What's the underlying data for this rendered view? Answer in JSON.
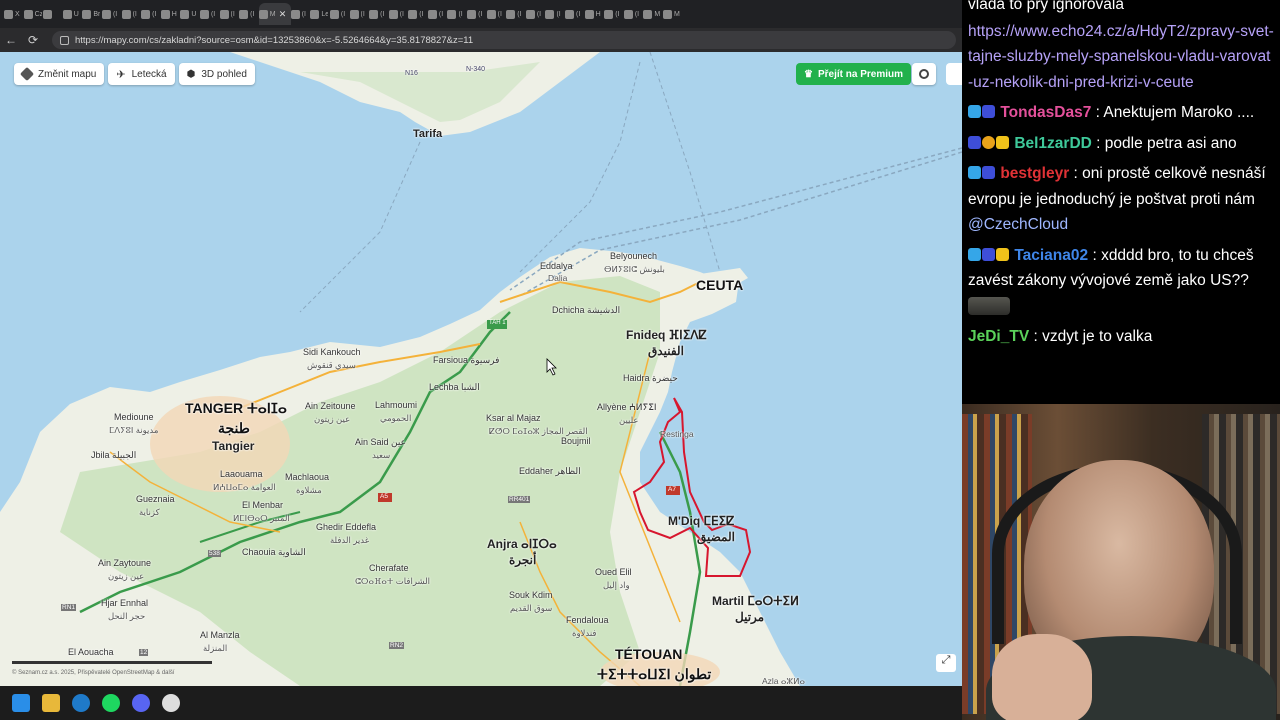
{
  "browser": {
    "tabs": [
      {
        "icon": "x-icon",
        "title": "X"
      },
      {
        "icon": "tab-icon",
        "title": "Cz"
      },
      {
        "icon": "tab-icon",
        "title": ""
      },
      {
        "icon": "tab-icon",
        "title": "U"
      },
      {
        "icon": "globe-icon",
        "title": "Br"
      },
      {
        "icon": "tab-icon",
        "title": "(I"
      },
      {
        "icon": "x-icon",
        "title": "(I"
      },
      {
        "icon": "x-icon",
        "title": "(I"
      },
      {
        "icon": "x-icon",
        "title": "H"
      },
      {
        "icon": "tab-icon",
        "title": "U"
      },
      {
        "icon": "x-icon",
        "title": "(I"
      },
      {
        "icon": "x-icon",
        "title": "(I"
      },
      {
        "icon": "x-icon",
        "title": "(I"
      },
      {
        "icon": "mapy-icon",
        "title": "M"
      },
      {
        "icon": "x-icon",
        "title": "(I"
      },
      {
        "icon": "tab-icon",
        "title": "Le"
      },
      {
        "icon": "x-icon",
        "title": "(I"
      },
      {
        "icon": "x-icon",
        "title": "(I"
      },
      {
        "icon": "x-icon",
        "title": "(I"
      },
      {
        "icon": "tab-icon",
        "title": "(I"
      },
      {
        "icon": "x-icon",
        "title": "(I"
      },
      {
        "icon": "x-icon",
        "title": "(I"
      },
      {
        "icon": "x-icon",
        "title": "(I"
      },
      {
        "icon": "x-icon",
        "title": "(I"
      },
      {
        "icon": "x-icon",
        "title": "(I"
      },
      {
        "icon": "x-icon",
        "title": "(I"
      },
      {
        "icon": "youtube-icon",
        "title": "(I"
      },
      {
        "icon": "x-icon",
        "title": "(I"
      },
      {
        "icon": "x-icon",
        "title": "(I"
      },
      {
        "icon": "x-icon",
        "title": "H"
      },
      {
        "icon": "x-icon",
        "title": "(I"
      },
      {
        "icon": "tab-icon",
        "title": "(I"
      },
      {
        "icon": "search-icon",
        "title": "M"
      },
      {
        "icon": "tiktok-icon",
        "title": "M"
      }
    ],
    "active_tab": {
      "title": "M"
    },
    "url": "https://mapy.com/cs/zakladni?source=osm&id=13253860&x=-5.5264664&y=35.8178827&z=11"
  },
  "map": {
    "toolbar": {
      "change_map": "Změnit mapu",
      "aerial": "Letecká",
      "view3d": "3D pohled"
    },
    "premium": "Přejít na Premium",
    "labels": {
      "tarifa": "Tarifa",
      "ceuta": "CEUTA",
      "tanger": "TANGER ⵜⴰⵏⵊⴰ",
      "tanger_ar": "طنجة",
      "tangier": "Tangier",
      "fnideq": "Fnideq ⴼⵏⵉⴷⵇ",
      "fnideq_ar": "الفنيدق",
      "tetouan": "TÉTOUAN",
      "tetouan_ar": "ⵜⵉⵜⵜⴰⵡⵉⵏ تطوان",
      "martil": "Martil ⵎⴰⵔⵜⵉⵍ",
      "martil_ar": "مرتيل",
      "mdiq": "M'Diq ⵎⴹⵉⵇ",
      "mdiq_ar": "المضيق",
      "anjra": "Anjra ⴰⵏⵊⵔⴰ",
      "anjra_ar": "أنجرة",
      "belyounech": "Belyounech",
      "belyounech_ar": "ⴱⵍⵢⵓⵏⵛ بليونش",
      "eddalya": "Eddalya",
      "dalia": "Dalia",
      "dchicha": "Dchicha الدشيشة",
      "sidi_kankouch": "Sidi Kankouch",
      "sidi_kankouch_ar": "سيدي قنقوش",
      "farsioua": "Farsioua فرسيوة",
      "lechba": "Lechba الشبا",
      "ksar": "Ksar al Majaz",
      "ksar_ar": "ⵇⵚⵔ ⵎⴰⵊⴰⵣ القصر المجاز",
      "haidra": "Haidra حيضرة",
      "allyene": "Allyène ⵄⵍⵢⵉⵏ",
      "allyene_ar": "عليين",
      "restinga": "Restinga",
      "boujmil": "Boujmil",
      "eddaher": "Eddaher الظاهر",
      "medioune": "Medioune",
      "medioune_ar": "ⵎⴷⵢⵓⵏ مديونة",
      "jbila": "Jbila الجبيلة",
      "ain_zeitoune": "Ain Zeitoune",
      "ain_zeitoune_ar": "عين زيتون",
      "lahmoumi": "Lahmoumi",
      "lahmoumi_ar": "الحمومي",
      "ain_said": "Ain Said عين",
      "ain_said_ar": "سعيد",
      "laaouama": "Laaouama",
      "laaouama_ar": "ⵍⵄⵡⴰⵎⴰ العوامة",
      "machlaoua": "Machlaoua",
      "machlaoua_ar": "مشلاوة",
      "gueznaia": "Gueznaia",
      "gueznaia_ar": "كزناية",
      "el_menbar": "El Menbar",
      "el_menbar_ar": "ⵍⵎⵏⴱⴰⵔ المنبر",
      "ghedir": "Ghedir Eddefla",
      "ghedir_ar": "غدير الدفلة",
      "chaouia": "Chaouia الشاوية",
      "cherafate": "Cherafate",
      "cherafate_ar": "ⵛⵔⴰⴼⴰⵜ الشرافات",
      "ain_zaytoune": "Ain Zaytoune",
      "ain_zaytoune_ar": "عين زيتون",
      "hjar": "Hjar Ennhal",
      "hjar_ar": "حجر النحل",
      "al_manzla": "Al Manzla",
      "al_manzla_ar": "المنزلة",
      "el_aouacha": "El Aouacha",
      "souk": "Souk Kdim",
      "souk_ar": "سوق القديم",
      "oued_elil": "Oued Elil",
      "oued_elil_ar": "واد إليل",
      "fendaloua": "Fendaloua",
      "fendaloua_ar": "فندلاوة",
      "azla": "Azla ⴰⵣⵍⴰ",
      "road_a5": "A5",
      "road_a7": "A7",
      "road_n340": "N-340",
      "road_n16": "N16",
      "road_538": "538",
      "road_rn1": "RN1",
      "road_rr401": "RR401",
      "road_rn2": "RN2",
      "road_12": "12",
      "road_tah1": "TAH 1"
    },
    "copyright": "© Seznam.cz a.s. 2025, Přispěvatelé OpenStreetMap & další"
  },
  "chat": {
    "messages": [
      {
        "user": "",
        "text": "vláda to prý ignorovala"
      },
      {
        "user": "",
        "text": "https://www.echo24.cz/a/HdyT2/zpravy-svet-tajne-sluzby-mely-spanelskou-vladu-varovat-uz-nekolik-dni-pred-krizi-v-ceute",
        "is_link": true
      },
      {
        "user": "TondasDas7",
        "color": "#e4509b",
        "text": "Anektujem Maroko ...."
      },
      {
        "user": "Bel1zarDD",
        "color": "#3ec99a",
        "text": "podle petra asi ano"
      },
      {
        "user": "bestgleyr",
        "color": "#e03236",
        "text": "oni prostě celkově nesnáší evropu je jednoduchý je poštvat proti nám",
        "mention": "@CzechCloud"
      },
      {
        "user": "Taciana02",
        "color": "#3f86e8",
        "text": "xdddd bro, to tu chceš zavést zákony vývojové země jako US??"
      },
      {
        "user": "JeDi_TV",
        "color": "#5bd25a",
        "text": "vzdyt je to valka"
      }
    ]
  },
  "colors": {
    "water": "#abd3ec",
    "land": "#eef0e6",
    "forest": "#cfe4c2",
    "motorway": "#3a9b4b",
    "main_road": "#f4b23a",
    "border": "#d7162e",
    "premium_green": "#22b14c"
  }
}
